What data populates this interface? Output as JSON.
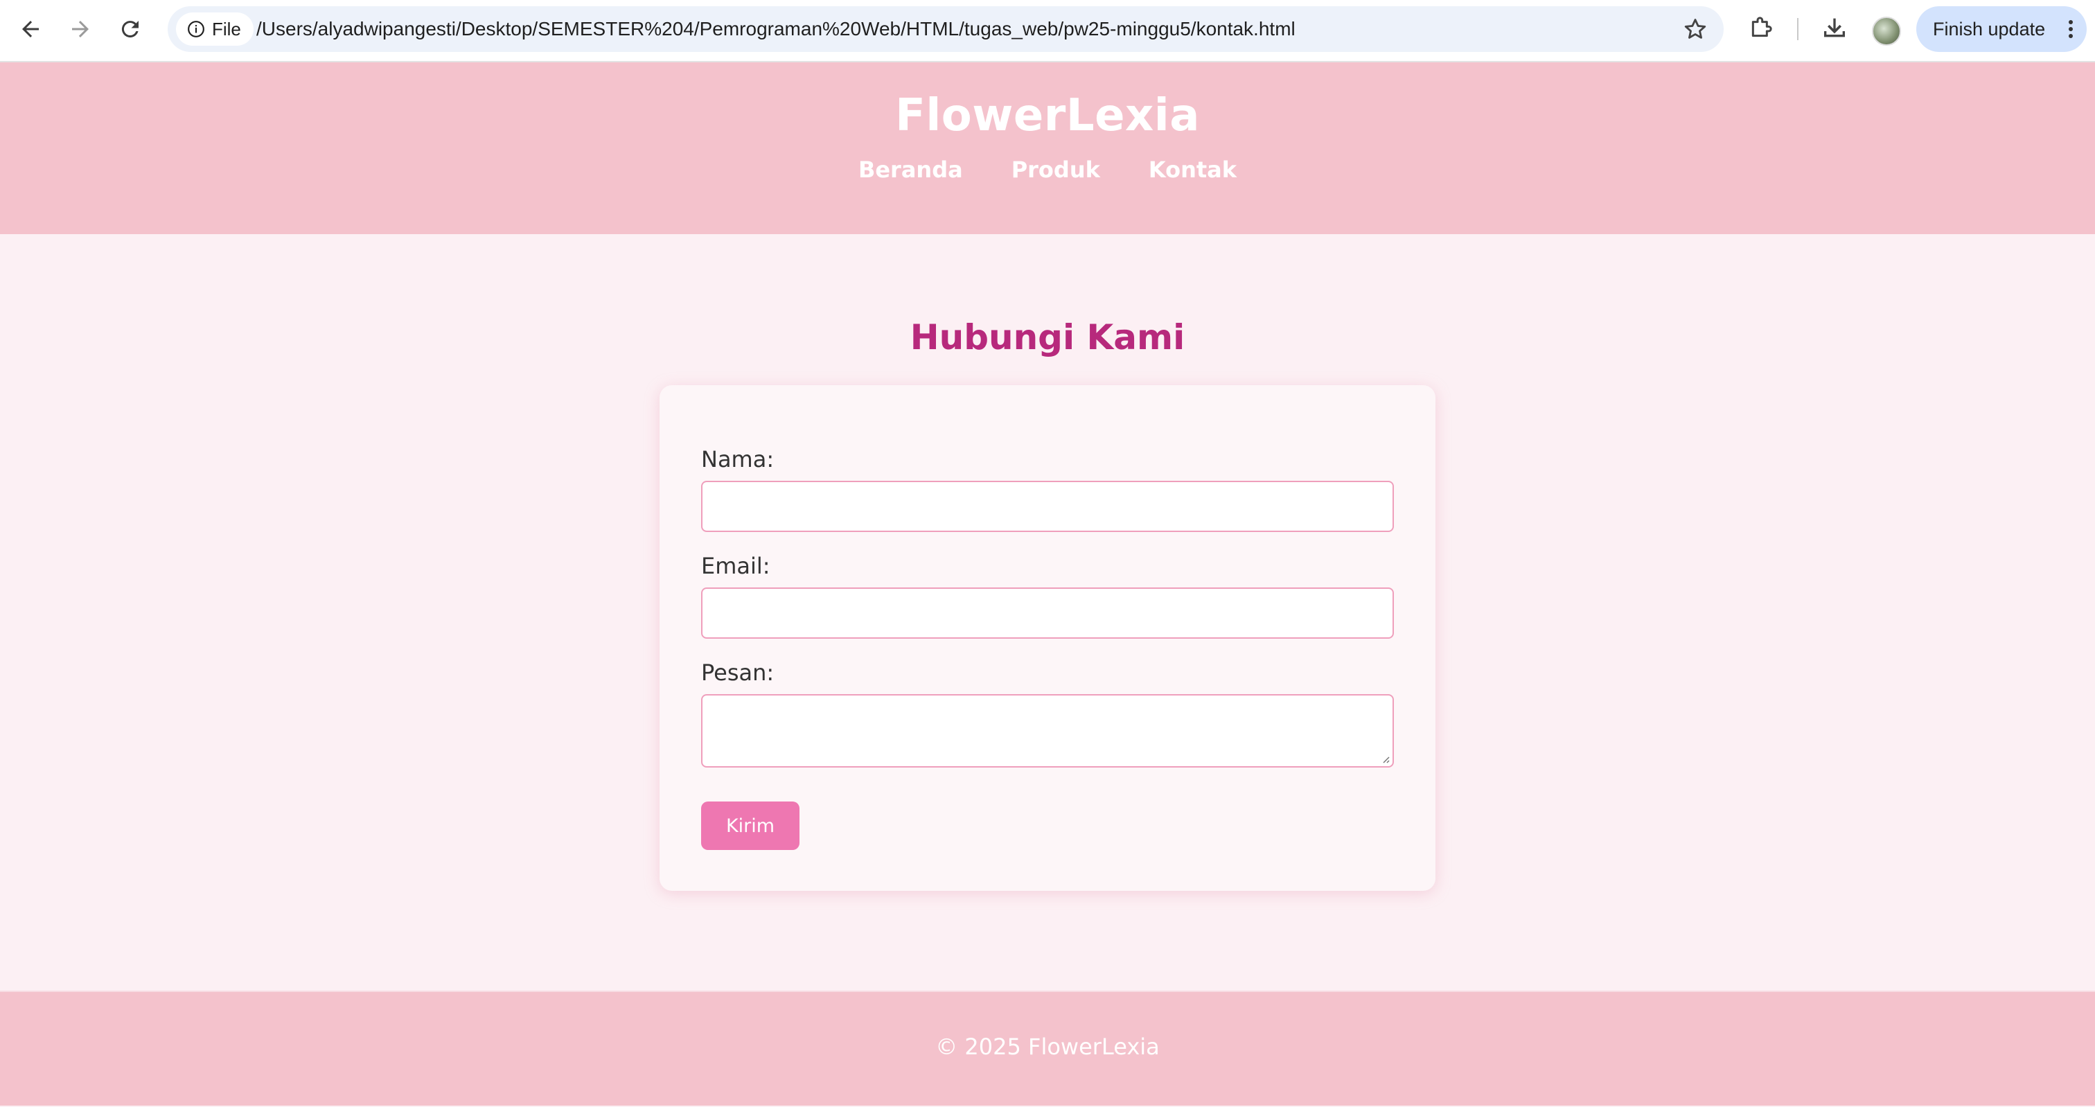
{
  "browser": {
    "site_chip_label": "File",
    "url": "/Users/alyadwipangesti/Desktop/SEMESTER%204/Pemrograman%20Web/HTML/tugas_web/pw25-minggu5/kontak.html",
    "update_button_label": "Finish update",
    "icons": [
      "back-arrow-icon",
      "forward-arrow-icon",
      "reload-icon",
      "info-icon",
      "star-icon",
      "extensions-icon",
      "download-icon",
      "profile-avatar",
      "more-vert-icon"
    ]
  },
  "site": {
    "title": "FlowerLexia",
    "nav": [
      {
        "label": "Beranda"
      },
      {
        "label": "Produk"
      },
      {
        "label": "Kontak"
      }
    ]
  },
  "contact": {
    "heading": "Hubungi Kami",
    "fields": [
      {
        "label": "Nama:",
        "value": ""
      },
      {
        "label": "Email:",
        "value": ""
      },
      {
        "label": "Pesan:",
        "value": ""
      }
    ],
    "submit_label": "Kirim"
  },
  "footer": {
    "text": "© 2025 FlowerLexia"
  },
  "colors": {
    "header_bg": "#f4c2cc",
    "page_bg": "#fcf0f4",
    "heading": "#b7297c",
    "input_border": "#ef9fbc",
    "button_bg": "#ee77b1"
  }
}
